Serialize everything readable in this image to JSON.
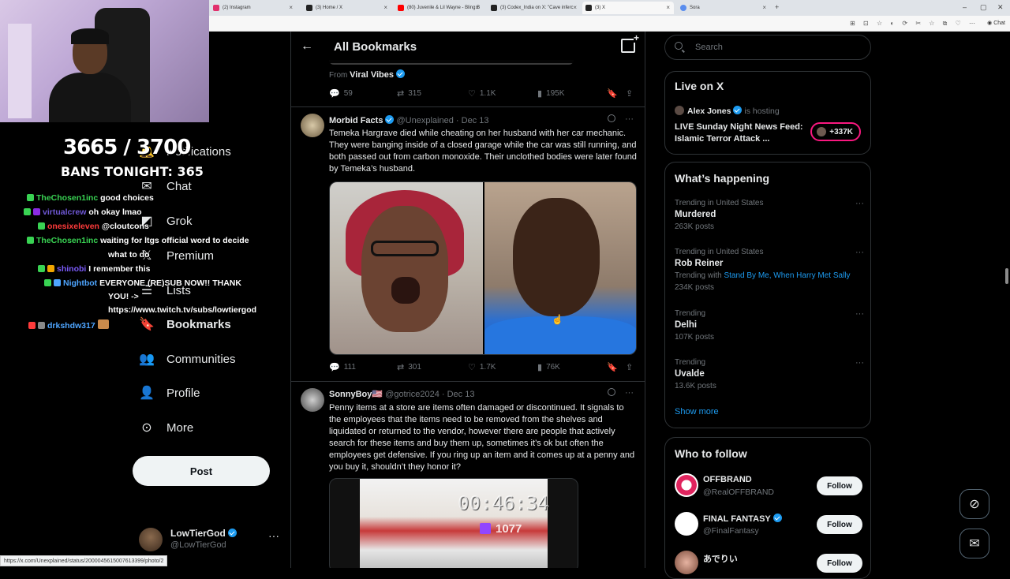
{
  "browser": {
    "tabs": [
      {
        "title": "(2) Instagram",
        "active": false
      },
      {
        "title": "(3) Home / X",
        "active": false
      },
      {
        "title": "(80) Juvenile & Lil Wayne - Bling B",
        "active": false
      },
      {
        "title": "(3) Codex_India on X: \"Cave inferc",
        "active": false
      },
      {
        "title": "(3) X",
        "active": true
      },
      {
        "title": "Sora",
        "active": false
      }
    ],
    "new_tab": "+",
    "window_controls": [
      "–",
      "▢",
      "✕"
    ],
    "chat_label": "Chat",
    "status_url": "https://x.com/Unexplained/status/2000045615007613399/photo/2"
  },
  "stream": {
    "counter": "3665 / 3700",
    "bans": "BANS TONIGHT: 365",
    "chat": [
      {
        "user": "TheChosen1inc",
        "msg": "good choices",
        "color": "#39d353"
      },
      {
        "user": "virtualcrew",
        "msg": "oh okay lmao",
        "color": "#6f58d6"
      },
      {
        "user": "onesixeleven",
        "msg": "@cloutcons",
        "color": "#ff3b3b"
      },
      {
        "user": "TheChosen1inc",
        "msg": "waiting for ltgs official word to decide",
        "color": "#39d353"
      },
      {
        "user": "",
        "msg": "what to do",
        "color": "#39d353"
      },
      {
        "user": "shinobi",
        "msg": "I remember this",
        "color": "#7a5af8"
      },
      {
        "user": "Nightbot",
        "msg": "EVERYONE (RE)SUB NOW!! THANK",
        "color": "#4ea5ff"
      },
      {
        "user": "",
        "msg": "YOU! ->",
        "color": "#4ea5ff"
      },
      {
        "user": "",
        "msg": "https://www.twitch.tv/subs/lowtiergod",
        "color": "#4ea5ff"
      },
      {
        "user": "drkshdw317",
        "msg": "",
        "color": "#4ea5ff"
      }
    ]
  },
  "nav": {
    "items": [
      {
        "label": "Notifications",
        "icon": "bell-icon"
      },
      {
        "label": "Chat",
        "icon": "mail-icon"
      },
      {
        "label": "Grok",
        "icon": "grok-icon"
      },
      {
        "label": "Premium",
        "icon": "x-logo-icon"
      },
      {
        "label": "Lists",
        "icon": "list-icon"
      },
      {
        "label": "Bookmarks",
        "icon": "bookmark-icon"
      },
      {
        "label": "Communities",
        "icon": "communities-icon"
      },
      {
        "label": "Profile",
        "icon": "person-icon"
      },
      {
        "label": "More",
        "icon": "more-icon"
      }
    ],
    "post_label": "Post",
    "account": {
      "name": "LowTierGod",
      "handle": "@LowTierGod",
      "more": "···"
    }
  },
  "main": {
    "title": "All Bookmarks",
    "top_tweet": {
      "from_prefix": "From",
      "from_name": "Viral Vibes",
      "replies": "59",
      "reposts": "315",
      "likes": "1.1K",
      "views": "195K"
    },
    "tweets": [
      {
        "name": "Morbid Facts",
        "handle": "@Unexplained",
        "date": "Dec 13",
        "text": "Temeka Hargrave died while cheating on her husband with her car mechanic. They were banging inside of a closed garage while the car was still running, and both passed out from carbon monoxide. Their unclothed bodies were later found by Temeka’s husband.",
        "replies": "111",
        "reposts": "301",
        "likes": "1.7K",
        "views": "76K"
      },
      {
        "name": "SonnyBoy🇺🇸",
        "handle": "@gotrice2024",
        "date": "Dec 13",
        "text": "Penny items at a store are items often damaged or discontinued. It signals to the employees that the items need to be removed from the shelves and liquidated or returned to the vendor, however there are people that actively search for these items and buy them up, sometimes it’s ok but often the employees get defensive. If you ring up an item and it comes up at a penny and you buy it, shouldn’t they honor it?"
      }
    ],
    "overlay_time": "00:46:34",
    "overlay_viewers": "1077"
  },
  "right": {
    "search_placeholder": "Search",
    "live": {
      "title": "Live on X",
      "host_name": "Alex Jones",
      "host_suffix": "is hosting",
      "broadcast": "LIVE Sunday Night News Feed: Islamic Terror Attack ...",
      "count": "+337K"
    },
    "happening": {
      "title": "What’s happening",
      "trends": [
        {
          "context": "Trending in United States",
          "topic": "Murdered",
          "posts": "263K posts",
          "with_label": "",
          "with_links": ""
        },
        {
          "context": "Trending in United States",
          "topic": "Rob Reiner",
          "posts": "234K posts",
          "with_label": "Trending with",
          "with_links": "Stand By Me, When Harry Met Sally"
        },
        {
          "context": "Trending",
          "topic": "Delhi",
          "posts": "107K posts",
          "with_label": "",
          "with_links": ""
        },
        {
          "context": "Trending",
          "topic": "Uvalde",
          "posts": "13.6K posts",
          "with_label": "",
          "with_links": ""
        }
      ],
      "show_more": "Show more"
    },
    "who_to_follow": {
      "title": "Who to follow",
      "accounts": [
        {
          "name": "OFFBRAND",
          "handle": "@RealOFFBRAND",
          "verified": false,
          "button": "Follow"
        },
        {
          "name": "FINAL FANTASY",
          "handle": "@FinalFantasy",
          "verified": true,
          "button": "Follow"
        },
        {
          "name": "あでりい",
          "handle": "",
          "verified": false,
          "button": "Follow"
        }
      ]
    }
  },
  "colors": {
    "accent": "#1d9bf0",
    "live": "#f91880",
    "bg": "#000000",
    "border": "#2f3336",
    "muted": "#71767b"
  }
}
